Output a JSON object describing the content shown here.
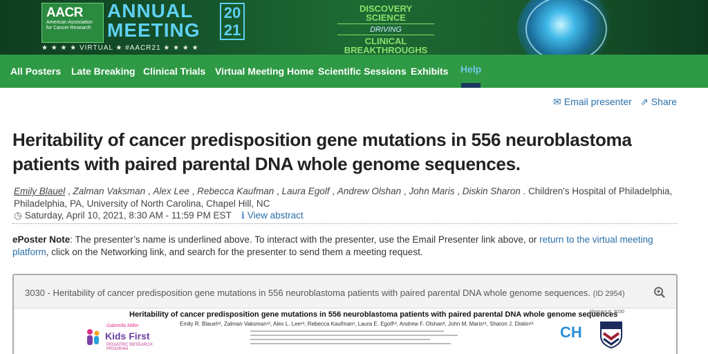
{
  "banner": {
    "org_logo": "AACR",
    "org_name": "American Association for Cancer Research",
    "annual": "ANNUAL",
    "meeting": "MEETING",
    "year_top": "20",
    "year_bottom": "21",
    "virtual_line": "★ ★ ★ ★ VIRTUAL ★ #AACR21 ★ ★ ★ ★",
    "tag_discovery": "DISCOVERY",
    "tag_science": "SCIENCE",
    "tag_driving": "DRIVING",
    "tag_clinical": "CLINICAL",
    "tag_breakthroughs": "BREAKTHROUGHS"
  },
  "nav": {
    "items": [
      {
        "label": "All Posters"
      },
      {
        "label": "Late Breaking"
      },
      {
        "label": "Clinical Trials"
      },
      {
        "label": "Virtual Meeting Home"
      },
      {
        "label": "Scientific Sessions"
      },
      {
        "label": "Exhibits"
      },
      {
        "label": "Help"
      }
    ],
    "active_index": 6
  },
  "actions": {
    "email_label": "Email presenter",
    "share_label": "Share",
    "email_icon": "envelope-icon",
    "share_icon": "share-icon"
  },
  "poster": {
    "title": "Heritability of cancer predisposition gene mutations in 556 neuroblastoma patients with paired parental DNA whole genome sequences.",
    "authors": [
      "Emily Blauel",
      "Zalman Vaksman",
      "Alex Lee",
      "Rebecca Kaufman",
      "Laura Egolf",
      "Andrew Olshan",
      "John Maris",
      "Diskin Sharon"
    ],
    "affiliations": "Children's Hospital of Philadelphia, Philadelphia, PA, University of North Carolina, Chapel Hill, NC",
    "date": "Saturday, April 10, 2021, 8:30 AM - 11:59 PM EST",
    "view_abstract": "View abstract"
  },
  "note": {
    "label": "ePoster Note",
    "text_a": ": The presenter’s name is underlined above. To interact with the presenter, use the Email Presenter link above, or ",
    "link": "return to the virtual meeting platform",
    "text_b": ", click on the Networking link, and search for the presenter to send them a meeting request."
  },
  "panel": {
    "heading": "3030 - Heritability of cancer predisposition gene mutations in 556 neuroblastoma patients with paired parental DNA whole genome sequences.",
    "id_label": "(ID 2954)",
    "zoom_icon": "zoom-in-icon"
  },
  "poster_image": {
    "title": "Heritability of cancer predisposition gene mutations in 556 neuroblastoma patients with paired parental DNA whole genome sequences",
    "authors": "Emily R. Blauel¹², Zalman Vaksman¹², Alex L. Lee¹², Rebecca Kaufman¹, Laura E. Egolf¹², Andrew F. Olshan³, John M. Maris¹², Sharon J. Diskin¹²",
    "abstract_no": "Abstract #: 3030",
    "kids_first": "Kids First",
    "kids_first_top": "Gabriella Miller",
    "kids_first_sub": "PEDIATRIC RESEARCH PROGRAM",
    "chop_logo": "CH"
  }
}
